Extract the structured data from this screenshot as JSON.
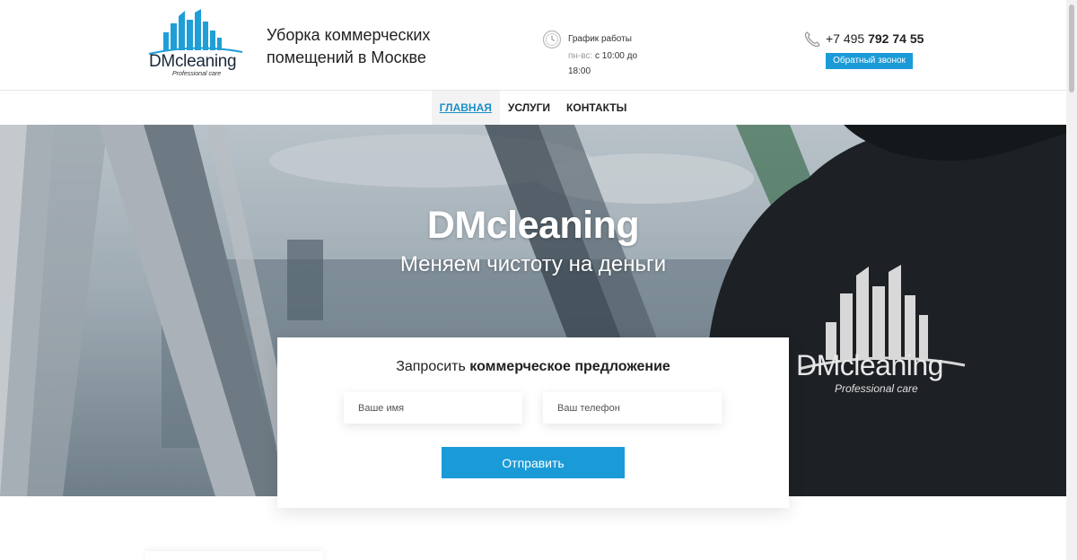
{
  "header": {
    "logo_text": "DMcleaning",
    "logo_sub": "Professional care",
    "tagline": "Уборка коммерческих помещений в Москве",
    "schedule_title": "График работы",
    "schedule_days": "пн-вс:",
    "schedule_hours": "с 10:00 до 18:00",
    "phone_prefix": "+7 495",
    "phone_number": "792 74 55",
    "callback_label": "Обратный звонок",
    "icons": {
      "clock": "clock-icon",
      "phone": "phone-icon"
    }
  },
  "nav": {
    "items": [
      {
        "label": "ГЛАВНАЯ",
        "active": true
      },
      {
        "label": "УСЛУГИ",
        "active": false
      },
      {
        "label": "КОНТАКТЫ",
        "active": false
      }
    ]
  },
  "hero": {
    "title": "DMcleaning",
    "subtitle": "Меняем чистоту на деньги",
    "shirt_logo_text": "DMcleaning",
    "shirt_logo_sub": "Professional care"
  },
  "form": {
    "title_prefix": "Запросить",
    "title_bold": "коммерческое предложение",
    "name_placeholder": "Ваше имя",
    "phone_placeholder": "Ваш телефон",
    "submit_label": "Отправить"
  },
  "colors": {
    "accent": "#1a9bd7",
    "nav_active": "#1a8fc9",
    "text": "#222222"
  }
}
